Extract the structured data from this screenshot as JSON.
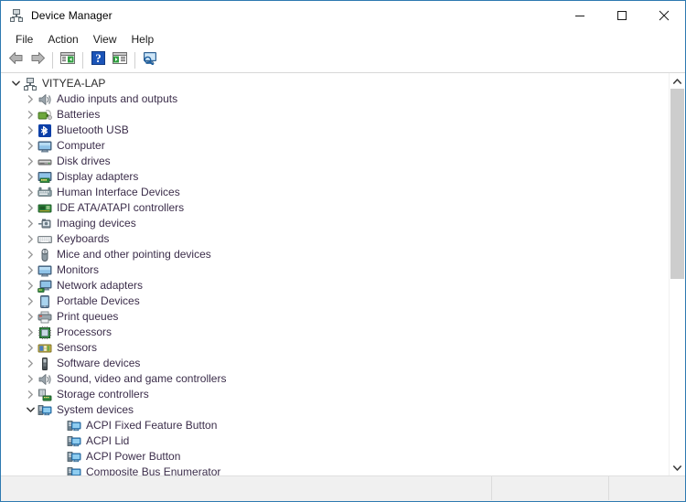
{
  "window": {
    "title": "Device Manager",
    "title_icon": "device-manager-icon",
    "controls": [
      {
        "name": "minimize-button",
        "glyph": "minimize"
      },
      {
        "name": "maximize-button",
        "glyph": "maximize"
      },
      {
        "name": "close-button",
        "glyph": "close"
      }
    ]
  },
  "menubar": {
    "items": [
      {
        "name": "menu-file",
        "label": "File"
      },
      {
        "name": "menu-action",
        "label": "Action"
      },
      {
        "name": "menu-view",
        "label": "View"
      },
      {
        "name": "menu-help",
        "label": "Help"
      }
    ]
  },
  "toolbar": {
    "buttons": [
      {
        "name": "back-button",
        "icon": "back-arrow-icon",
        "title": "Back"
      },
      {
        "name": "forward-button",
        "icon": "forward-arrow-icon",
        "title": "Forward"
      },
      {
        "name": "show-hide-console-tree-button",
        "icon": "console-tree-icon",
        "title": "Show/Hide Console Tree"
      },
      {
        "name": "help-button",
        "icon": "help-question-icon",
        "title": "Help"
      },
      {
        "name": "properties-button",
        "icon": "properties-icon",
        "title": "Properties"
      },
      {
        "name": "scan-hardware-changes-button",
        "icon": "scan-monitor-icon",
        "title": "Scan for hardware changes"
      }
    ]
  },
  "tree": {
    "root": {
      "name": "tree-root-vityea-lap",
      "label": "VITYEA-LAP",
      "icon": "computer-node-icon",
      "expanded": true,
      "chevron": "chevron-down"
    },
    "categories": [
      {
        "name": "tree-item-audio-inputs-and-outputs",
        "label": "Audio inputs and outputs",
        "icon": "speaker-icon",
        "expanded": false,
        "chevron": "chevron-right"
      },
      {
        "name": "tree-item-batteries",
        "label": "Batteries",
        "icon": "battery-icon",
        "expanded": false,
        "chevron": "chevron-right"
      },
      {
        "name": "tree-item-bluetooth-usb",
        "label": "Bluetooth USB",
        "icon": "bluetooth-icon",
        "expanded": false,
        "chevron": "chevron-right"
      },
      {
        "name": "tree-item-computer",
        "label": "Computer",
        "icon": "monitor-icon",
        "expanded": false,
        "chevron": "chevron-right"
      },
      {
        "name": "tree-item-disk-drives",
        "label": "Disk drives",
        "icon": "disk-drive-icon",
        "expanded": false,
        "chevron": "chevron-right"
      },
      {
        "name": "tree-item-display-adapters",
        "label": "Display adapters",
        "icon": "display-adapter-icon",
        "expanded": false,
        "chevron": "chevron-right"
      },
      {
        "name": "tree-item-human-interface-devices",
        "label": "Human Interface Devices",
        "icon": "hid-icon",
        "expanded": false,
        "chevron": "chevron-right"
      },
      {
        "name": "tree-item-ide-ata-atapi-controllers",
        "label": "IDE ATA/ATAPI controllers",
        "icon": "ide-controller-icon",
        "expanded": false,
        "chevron": "chevron-right"
      },
      {
        "name": "tree-item-imaging-devices",
        "label": "Imaging devices",
        "icon": "imaging-device-icon",
        "expanded": false,
        "chevron": "chevron-right"
      },
      {
        "name": "tree-item-keyboards",
        "label": "Keyboards",
        "icon": "keyboard-icon",
        "expanded": false,
        "chevron": "chevron-right"
      },
      {
        "name": "tree-item-mice-and-other-pointing-devices",
        "label": "Mice and other pointing devices",
        "icon": "mouse-icon",
        "expanded": false,
        "chevron": "chevron-right"
      },
      {
        "name": "tree-item-monitors",
        "label": "Monitors",
        "icon": "monitor-icon",
        "expanded": false,
        "chevron": "chevron-right"
      },
      {
        "name": "tree-item-network-adapters",
        "label": "Network adapters",
        "icon": "network-adapter-icon",
        "expanded": false,
        "chevron": "chevron-right"
      },
      {
        "name": "tree-item-portable-devices",
        "label": "Portable Devices",
        "icon": "portable-device-icon",
        "expanded": false,
        "chevron": "chevron-right"
      },
      {
        "name": "tree-item-print-queues",
        "label": "Print queues",
        "icon": "printer-icon",
        "expanded": false,
        "chevron": "chevron-right"
      },
      {
        "name": "tree-item-processors",
        "label": "Processors",
        "icon": "processor-icon",
        "expanded": false,
        "chevron": "chevron-right"
      },
      {
        "name": "tree-item-sensors",
        "label": "Sensors",
        "icon": "sensor-icon",
        "expanded": false,
        "chevron": "chevron-right"
      },
      {
        "name": "tree-item-software-devices",
        "label": "Software devices",
        "icon": "software-device-icon",
        "expanded": false,
        "chevron": "chevron-right"
      },
      {
        "name": "tree-item-sound-video-and-game-controllers",
        "label": "Sound, video and game controllers",
        "icon": "speaker-icon",
        "expanded": false,
        "chevron": "chevron-right"
      },
      {
        "name": "tree-item-storage-controllers",
        "label": "Storage controllers",
        "icon": "storage-controller-icon",
        "expanded": false,
        "chevron": "chevron-right"
      },
      {
        "name": "tree-item-system-devices",
        "label": "System devices",
        "icon": "system-device-icon",
        "expanded": true,
        "chevron": "chevron-down"
      }
    ],
    "system_devices_children": [
      {
        "name": "tree-child-acpi-fixed-feature-button",
        "label": "ACPI Fixed Feature Button",
        "icon": "system-device-icon"
      },
      {
        "name": "tree-child-acpi-lid",
        "label": "ACPI Lid",
        "icon": "system-device-icon"
      },
      {
        "name": "tree-child-acpi-power-button",
        "label": "ACPI Power Button",
        "icon": "system-device-icon"
      },
      {
        "name": "tree-child-composite-bus-enumerator",
        "label": "Composite Bus Enumerator",
        "icon": "system-device-icon"
      }
    ]
  },
  "scrollbar": {
    "name": "vertical-scrollbar",
    "up_arrow": "scroll-up-arrow-icon",
    "down_arrow": "scroll-down-arrow-icon",
    "thumb": "scrollbar-thumb"
  },
  "statusbar": {
    "panes": [
      {
        "name": "status-pane-main",
        "text": ""
      },
      {
        "name": "status-pane-second",
        "text": ""
      },
      {
        "name": "status-pane-third",
        "text": ""
      }
    ]
  },
  "colors": {
    "window_border": "#2e7ab0",
    "tree_text": "#3b2d4a",
    "titlebar_bg": "#ffffff",
    "statusbar_bg": "#f0f0f0",
    "scrollbar_thumb": "#cdcdcd"
  }
}
